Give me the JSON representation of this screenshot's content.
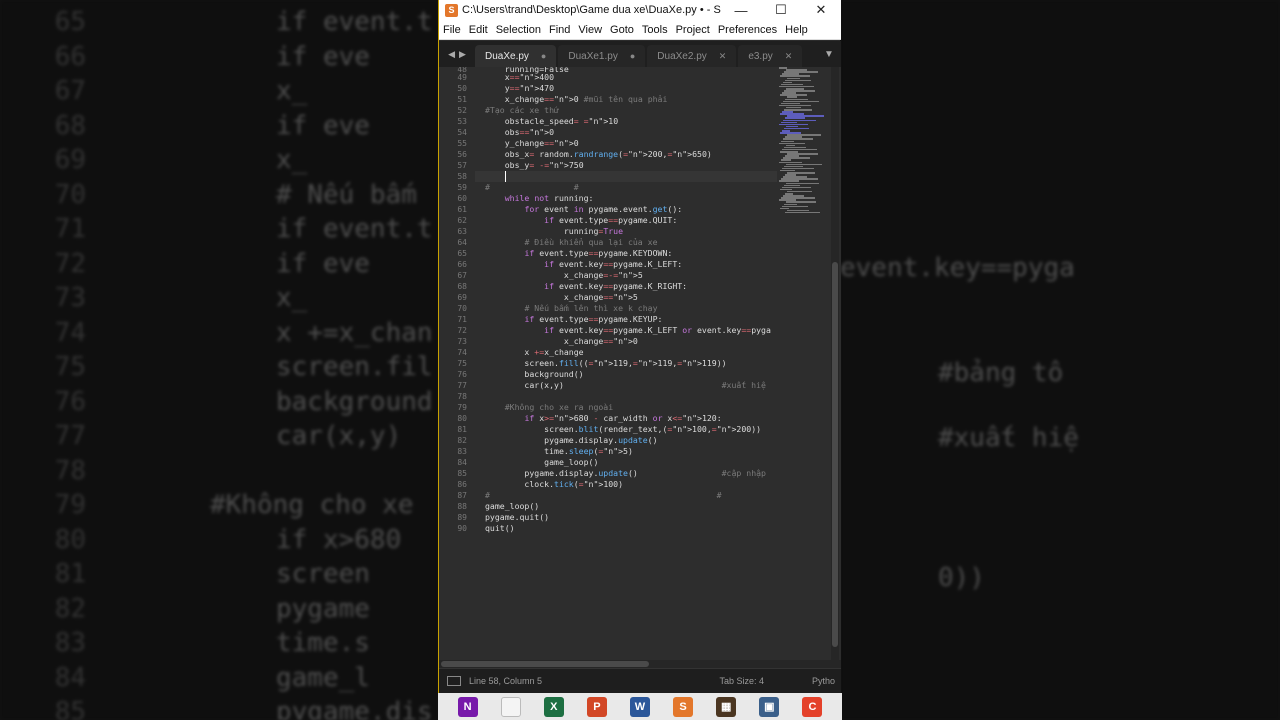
{
  "window": {
    "title": "C:\\Users\\trand\\Desktop\\Game dua xe\\DuaXe.py • - Subli...",
    "controls": {
      "minimize": "—",
      "maximize": "☐",
      "close": "✕"
    }
  },
  "menubar": [
    "File",
    "Edit",
    "Selection",
    "Find",
    "View",
    "Goto",
    "Tools",
    "Project",
    "Preferences",
    "Help"
  ],
  "tabs": [
    {
      "label": "DuaXe.py",
      "marker": "●",
      "active": true
    },
    {
      "label": "DuaXe1.py",
      "marker": "●",
      "active": false
    },
    {
      "label": "DuaXe2.py",
      "marker": "✕",
      "active": false
    },
    {
      "label": "e3.py",
      "marker": "✕",
      "active": false
    }
  ],
  "editor": {
    "line_numbers": [
      "49",
      "50",
      "51",
      "52",
      "53",
      "54",
      "55",
      "56",
      "57",
      "58",
      "59",
      "60",
      "61",
      "62",
      "63",
      "64",
      "65",
      "66",
      "67",
      "68",
      "69",
      "70",
      "71",
      "72",
      "73",
      "74",
      "75",
      "76",
      "77",
      "78",
      "79",
      "80",
      "81",
      "82",
      "83",
      "84",
      "85",
      "86",
      "87",
      "88",
      "89",
      "90"
    ],
    "lines": [
      "    x=400",
      "    y=470",
      "    x_change=0 #mũi tên qua phải",
      "#Tạo các xe thứ",
      "    obstacle_speed= 10",
      "    obs=0",
      "    y_change=0",
      "    obs_x= random.randrange(200,650)",
      "    obs_y= -750",
      "    ",
      "#                 #",
      "    while not running:",
      "        for event in pygame.event.get():",
      "            if event.type==pygame.QUIT:",
      "                running=True",
      "        # Điều khiển qua lại của xe",
      "        if event.type==pygame.KEYDOWN:",
      "            if event.key==pygame.K_LEFT:",
      "                x_change=-5",
      "            if event.key==pygame.K_RIGHT:",
      "                x_change=5",
      "        # Nếu bấm lên thì xe k chạy",
      "        if event.type==pygame.KEYUP:",
      "            if event.key==pygame.K_LEFT or event.key==pyga",
      "                x_change=0",
      "        x +=x_change",
      "        screen.fill((119,119,119))              #bảng tô",
      "        background()",
      "        car(x,y)                                #xuất hiệ",
      "",
      "    #Không cho xe ra ngoài",
      "        if x>680 - car_width or x<120:",
      "            screen.blit(render_text,(100,200))",
      "            pygame.display.update()",
      "            time.sleep(5)",
      "            game_loop()",
      "        pygame.display.update()                 #cập nhập",
      "        clock.tick(100)",
      "#                                              #",
      "game_loop()",
      "pygame.quit()",
      "quit()"
    ],
    "partial_top_line": "    running=False",
    "partial_top_number": "48"
  },
  "statusbar": {
    "position": "Line 58, Column 5",
    "tab_size": "Tab Size: 4",
    "syntax": "Pytho"
  },
  "taskbar": [
    {
      "name": "onenote-icon",
      "glyph": "N",
      "color": "#7719aa"
    },
    {
      "name": "file-icon",
      "glyph": "",
      "color": "#f4f4f4"
    },
    {
      "name": "excel-icon",
      "glyph": "X",
      "color": "#1d6f42"
    },
    {
      "name": "powerpoint-icon",
      "glyph": "P",
      "color": "#d24726"
    },
    {
      "name": "word-icon",
      "glyph": "W",
      "color": "#2b579a"
    },
    {
      "name": "sublime-icon",
      "glyph": "S",
      "color": "#e3772b"
    },
    {
      "name": "minecraft-icon",
      "glyph": "▦",
      "color": "#4b3621"
    },
    {
      "name": "pc-icon",
      "glyph": "▣",
      "color": "#3a5f8a"
    },
    {
      "name": "ccleaner-icon",
      "glyph": "C",
      "color": "#e4412a"
    }
  ],
  "backdrop_left": {
    "numbers": [
      "65",
      "66",
      "67",
      "68",
      "69",
      "70",
      "71",
      "72",
      "73",
      "74",
      "75",
      "76",
      "77",
      "78",
      "79",
      "80",
      "81",
      "82",
      "83",
      "84",
      "85"
    ],
    "code": [
      "if event.t",
      "    if eve",
      "        x_",
      "    if eve",
      "        x_",
      "# Nếu bấm",
      "if event.t",
      "    if eve",
      "        x_",
      "x +=x_chan",
      "screen.fil",
      "background",
      "car(x,y)",
      "",
      "#Không cho xe",
      "if x>680",
      "    screen",
      "    pygame",
      "    time.s",
      "    game_l",
      "pygame.dis"
    ]
  },
  "backdrop_right": {
    "code": [
      "event.key==pyga",
      "",
      "#bảng tô",
      "",
      "#xuất hiệ",
      "",
      "",
      "0))"
    ]
  },
  "colors": {
    "accent": "#c8a100",
    "editor_bg": "#2d2d2d",
    "keyword": "#c678dd"
  }
}
